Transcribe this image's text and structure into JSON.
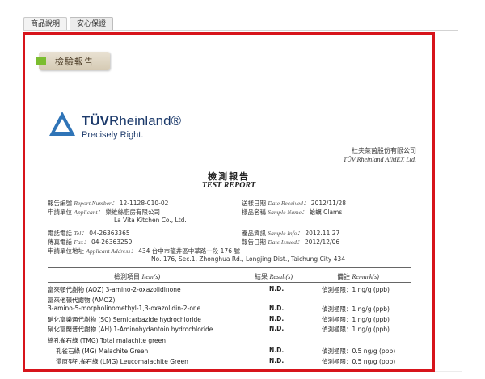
{
  "tabs": [
    {
      "label": "商品說明",
      "active": false
    },
    {
      "label": "安心保證",
      "active": true
    }
  ],
  "badge": {
    "label": "檢驗報告",
    "accent": "#7bbd2f"
  },
  "frame_color": "#d7141b",
  "report": {
    "brand_prefix": "TÜV",
    "brand_name": "Rheinland®",
    "slogan": "Precisely Right.",
    "company_cn": "杜夫萊茵股份有限公司",
    "company_en": "TÜV Rheinland AIMEX Ltd.",
    "title_cn": "檢測報告",
    "title_en": "TEST REPORT",
    "report_number_label": "報告編號",
    "report_number_label_en": "Report Number：",
    "report_number": "12-1128-010-02",
    "applicant_label": "申請單位",
    "applicant_label_en": "Applicant：",
    "applicant_cn": "樂維絲廚房有限公司",
    "applicant_en": "La Vita Kitchen Co., Ltd.",
    "tel_label": "電話電話",
    "tel_label_en": "Tel：",
    "tel": "04-26363365",
    "fax_label": "傳真電話",
    "fax_label_en": "Fax：",
    "fax": "04-26363259",
    "address_label": "申請單位地址",
    "address_label_en": "Applicant Address：",
    "address_cn": "434 台中市龍井區中華路一段 176 號",
    "address_en": "No. 176, Sec.1, Zhonghua Rd., Longjing Dist., Taichung City 434",
    "date_received_label": "送樣日期",
    "date_received_label_en": "Date Received：",
    "date_received": "2012/11/28",
    "sample_name_label": "樣品名稱",
    "sample_name_label_en": "Sample Name：",
    "sample_name": "蛤蠣 Clams",
    "sample_info_label": "產品資訊",
    "sample_info_label_en": "Sample Info：",
    "sample_info": "2012.11.27",
    "date_issued_label": "報告日期",
    "date_issued_label_en": "Date Issued：",
    "date_issued": "2012/12/06",
    "table_headers": {
      "item_cn": "檢測項目",
      "item_en": "Item(s)",
      "result_cn": "結果",
      "result_en": "Result(s)",
      "remark_cn": "備註",
      "remark_en": "Remark(s)"
    },
    "rows": [
      {
        "item": "富來頓代謝物 (AOZ) 3-amino-2-oxazolidinone",
        "result": "N.D.",
        "remark": "偵測極限：1 ng/g (ppb)"
      },
      {
        "item": "富來他頓代謝物 (AMOZ)",
        "result": "",
        "remark": ""
      },
      {
        "item": "3-amino-5-morpholinomethyl-1,3-oxazolidin-2-one",
        "result": "N.D.",
        "remark": "偵測極限：1 ng/g (ppb)"
      },
      {
        "item": "硝化富樂通代謝物 (SC) Semicarbazide hydrochloride",
        "result": "N.D.",
        "remark": "偵測極限：1 ng/g (ppb)"
      },
      {
        "item": "硝化富蘭普代謝物 (AH) 1-Aminohydantoin hydrochloride",
        "result": "N.D.",
        "remark": "偵測極限：1 ng/g (ppb)"
      },
      {
        "item": "總孔雀石綠 (TMG) Total malachite green",
        "result": "",
        "remark": ""
      },
      {
        "item": "孔雀石綠 (MG) Malachite Green",
        "result": "N.D.",
        "remark": "偵測極限：0.5 ng/g (ppb)"
      },
      {
        "item": "還原型孔雀石綠 (LMG) Leucomalachite Green",
        "result": "N.D.",
        "remark": "偵測極限：0.5 ng/g (ppb)"
      }
    ]
  }
}
